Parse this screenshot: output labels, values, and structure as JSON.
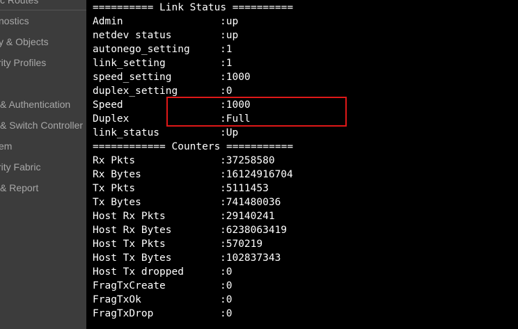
{
  "sidebar": {
    "items": [
      "c Routes",
      "nostics",
      "y & Objects",
      "rity Profiles",
      "& Authentication",
      "& Switch Controller",
      "em",
      "rity Fabric",
      "& Report"
    ]
  },
  "terminal": {
    "link_status_header": "========== Link Status ==========",
    "link_status": [
      {
        "key": "Admin",
        "value": ":up"
      },
      {
        "key": "netdev status",
        "value": ":up"
      },
      {
        "key": "autonego_setting",
        "value": ":1"
      },
      {
        "key": "link_setting",
        "value": ":1"
      },
      {
        "key": "speed_setting",
        "value": ":1000"
      },
      {
        "key": "duplex_setting",
        "value": ":0"
      },
      {
        "key": "Speed",
        "value": ":1000"
      },
      {
        "key": "Duplex",
        "value": ":Full"
      },
      {
        "key": "link_status",
        "value": ":Up"
      }
    ],
    "counters_header": "============ Counters ===========",
    "counters": [
      {
        "key": "Rx Pkts",
        "value": ":37258580"
      },
      {
        "key": "Rx Bytes",
        "value": ":16124916704"
      },
      {
        "key": "Tx Pkts",
        "value": ":5111453"
      },
      {
        "key": "Tx Bytes",
        "value": ":741480036"
      },
      {
        "key": "Host Rx Pkts",
        "value": ":29140241"
      },
      {
        "key": "Host Rx Bytes",
        "value": ":6238063419"
      },
      {
        "key": "Host Tx Pkts",
        "value": ":570219"
      },
      {
        "key": "Host Tx Bytes",
        "value": ":102837343"
      },
      {
        "key": "Host Tx dropped",
        "value": ":0"
      },
      {
        "key": "FragTxCreate",
        "value": ":0"
      },
      {
        "key": "FragTxOk",
        "value": ":0"
      },
      {
        "key": "FragTxDrop",
        "value": ":0"
      }
    ]
  },
  "colors": {
    "highlight": "#e01818",
    "terminal_bg": "#000000",
    "sidebar_bg": "#3c3c3c"
  }
}
